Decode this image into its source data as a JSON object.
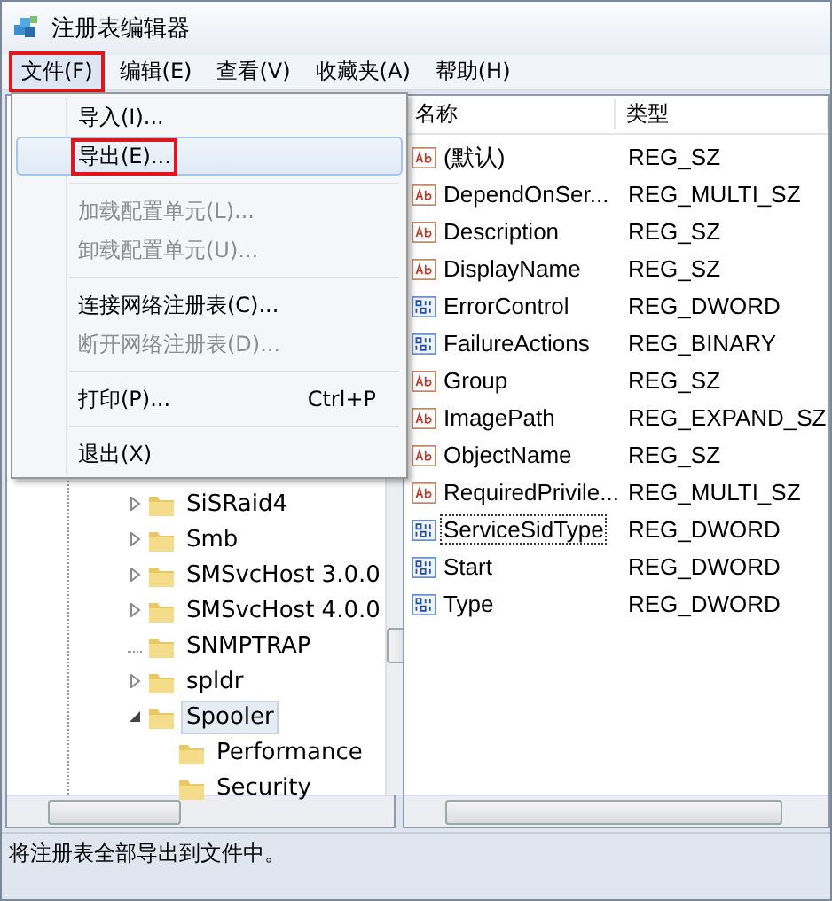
{
  "window": {
    "title": "注册表编辑器"
  },
  "menubar": [
    {
      "label": "文件(F)",
      "selected": true,
      "annotated": true
    },
    {
      "label": "编辑(E)",
      "selected": false,
      "annotated": false
    },
    {
      "label": "查看(V)",
      "selected": false,
      "annotated": false
    },
    {
      "label": "收藏夹(A)",
      "selected": false,
      "annotated": false
    },
    {
      "label": "帮助(H)",
      "selected": false,
      "annotated": false
    }
  ],
  "file_menu": [
    {
      "kind": "item",
      "label": "导入(I)...",
      "disabled": false,
      "selected": false,
      "annotated": false
    },
    {
      "kind": "item",
      "label": "导出(E)...",
      "disabled": false,
      "selected": true,
      "annotated": true
    },
    {
      "kind": "separator"
    },
    {
      "kind": "item",
      "label": "加载配置单元(L)...",
      "disabled": true,
      "selected": false,
      "annotated": false
    },
    {
      "kind": "item",
      "label": "卸载配置单元(U)...",
      "disabled": true,
      "selected": false,
      "annotated": false
    },
    {
      "kind": "separator"
    },
    {
      "kind": "item",
      "label": "连接网络注册表(C)...",
      "disabled": false,
      "selected": false,
      "annotated": false
    },
    {
      "kind": "item",
      "label": "断开网络注册表(D)...",
      "disabled": true,
      "selected": false,
      "annotated": false
    },
    {
      "kind": "separator"
    },
    {
      "kind": "item",
      "label": "打印(P)...",
      "shortcut": "Ctrl+P",
      "disabled": false,
      "selected": false,
      "annotated": false
    },
    {
      "kind": "separator"
    },
    {
      "kind": "item",
      "label": "退出(X)",
      "disabled": false,
      "selected": false,
      "annotated": false
    }
  ],
  "tree": [
    {
      "label": "SiSRaid4",
      "expanded": false,
      "has_children": true,
      "selected": false
    },
    {
      "label": "Smb",
      "expanded": false,
      "has_children": true,
      "selected": false
    },
    {
      "label": "SMSvcHost 3.0.0",
      "expanded": false,
      "has_children": true,
      "selected": false
    },
    {
      "label": "SMSvcHost 4.0.0",
      "expanded": false,
      "has_children": true,
      "selected": false
    },
    {
      "label": "SNMPTRAP",
      "has_children": false,
      "selected": false
    },
    {
      "label": "spldr",
      "expanded": false,
      "has_children": true,
      "selected": false
    },
    {
      "label": "Spooler",
      "expanded": true,
      "has_children": true,
      "selected": true,
      "children": [
        {
          "label": "Performance",
          "selected": false
        },
        {
          "label": "Security",
          "selected": false
        }
      ]
    }
  ],
  "values": {
    "columns": [
      "名称",
      "类型"
    ],
    "rows": [
      {
        "kind": "string",
        "name": "(默认)",
        "type": "REG_SZ",
        "selected": false
      },
      {
        "kind": "string",
        "name": "DependOnSer...",
        "type": "REG_MULTI_SZ",
        "selected": false
      },
      {
        "kind": "string",
        "name": "Description",
        "type": "REG_SZ",
        "selected": false
      },
      {
        "kind": "string",
        "name": "DisplayName",
        "type": "REG_SZ",
        "selected": false
      },
      {
        "kind": "binary",
        "name": "ErrorControl",
        "type": "REG_DWORD",
        "selected": false
      },
      {
        "kind": "binary",
        "name": "FailureActions",
        "type": "REG_BINARY",
        "selected": false
      },
      {
        "kind": "string",
        "name": "Group",
        "type": "REG_SZ",
        "selected": false
      },
      {
        "kind": "string",
        "name": "ImagePath",
        "type": "REG_EXPAND_SZ",
        "selected": false
      },
      {
        "kind": "string",
        "name": "ObjectName",
        "type": "REG_SZ",
        "selected": false
      },
      {
        "kind": "string",
        "name": "RequiredPrivile...",
        "type": "REG_MULTI_SZ",
        "selected": false
      },
      {
        "kind": "binary",
        "name": "ServiceSidType",
        "type": "REG_DWORD",
        "selected": true
      },
      {
        "kind": "binary",
        "name": "Start",
        "type": "REG_DWORD",
        "selected": false
      },
      {
        "kind": "binary",
        "name": "Type",
        "type": "REG_DWORD",
        "selected": false
      }
    ]
  },
  "status_bar": "将注册表全部导出到文件中。"
}
